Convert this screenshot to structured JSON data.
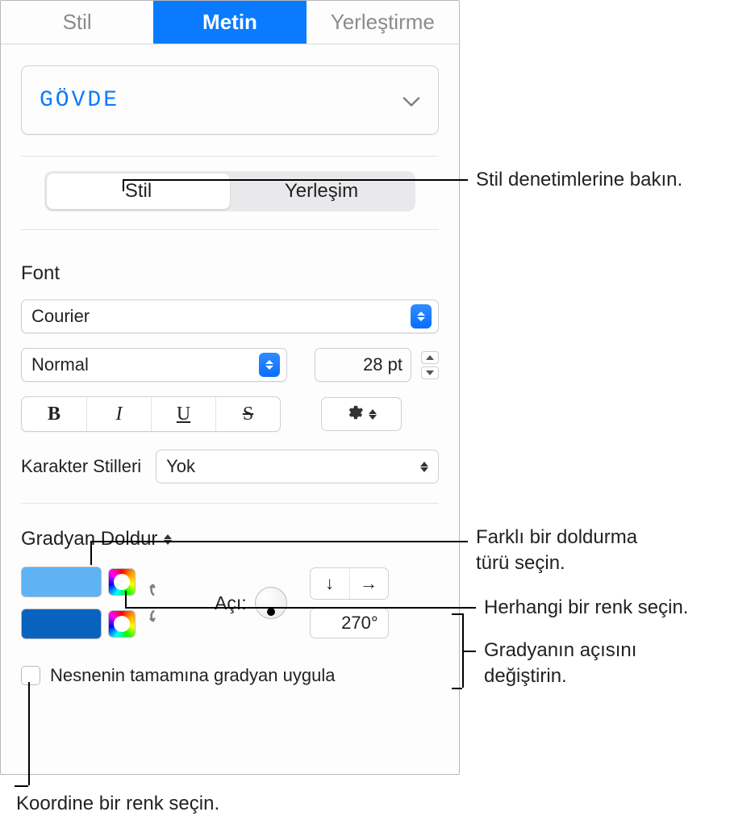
{
  "top_tabs": {
    "stil": "Stil",
    "metin": "Metin",
    "yerlestirme": "Yerleştirme"
  },
  "paragraph_style": "GÖVDE",
  "sub_tabs": {
    "stil": "Stil",
    "yerlesim": "Yerleşim"
  },
  "font": {
    "section_label": "Font",
    "family": "Courier",
    "typeface": "Normal",
    "size": "28 pt"
  },
  "char_styles": {
    "label": "Karakter Stilleri",
    "value": "Yok"
  },
  "gradient": {
    "label": "Gradyan Doldur",
    "angle_label": "Açı:",
    "angle_value": "270°",
    "checkbox_label": "Nesnenin tamamına gradyan uygula"
  },
  "callouts": {
    "c1": "Stil denetimlerine bakın.",
    "c2": "Farklı bir doldurma\ntürü seçin.",
    "c3": "Herhangi bir renk seçin.",
    "c4": "Gradyanın açısını\ndeğiştirin.",
    "c5": "Koordine bir renk seçin."
  }
}
